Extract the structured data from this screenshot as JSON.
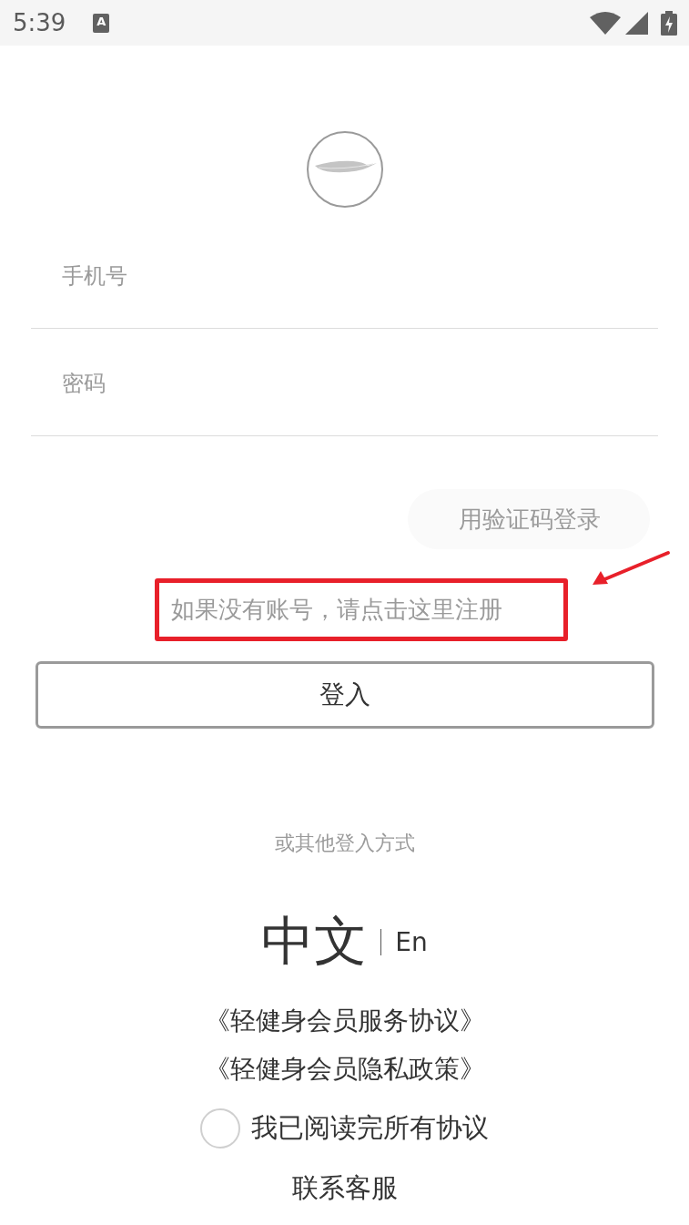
{
  "status_bar": {
    "time": "5:39",
    "notification_glyph": "A"
  },
  "phone_field": {
    "placeholder": "手机号"
  },
  "password_field": {
    "placeholder": "密码"
  },
  "code_login_button": {
    "label": "用验证码登录"
  },
  "register_link": {
    "text": "如果没有账号，请点击这里注册",
    "highlighted": true
  },
  "login_button": {
    "label": "登入"
  },
  "other_login": {
    "label": "或其他登入方式"
  },
  "language_options": [
    {
      "label": "中文",
      "selected": true
    },
    {
      "label": "En",
      "selected": false
    }
  ],
  "agreements": [
    {
      "label": "《轻健身会员服务协议》"
    },
    {
      "label": "《轻健身会员隐私政策》"
    }
  ],
  "agree_checkbox": {
    "label": "我已阅读完所有协议",
    "checked": false
  },
  "contact_link": {
    "label": "联系客服"
  }
}
